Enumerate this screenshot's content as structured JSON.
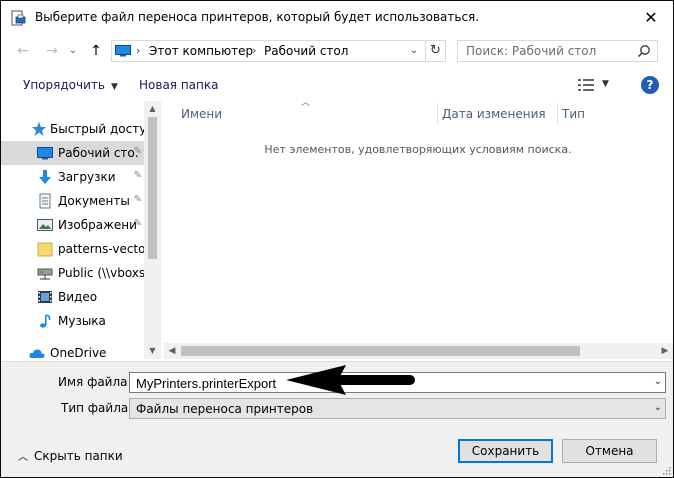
{
  "window": {
    "title": "Выберите файл переноса принтеров, который будет использоваться.",
    "close_glyph": "✕"
  },
  "navigation": {
    "back_glyph": "←",
    "forward_glyph": "→",
    "recent_glyph": "⌄",
    "up_glyph": "↑"
  },
  "address": {
    "crumbs": [
      "Этот компьютер",
      "Рабочий стол"
    ],
    "separator": "›",
    "dropdown_glyph": "⌄",
    "refresh_glyph": "↻"
  },
  "search": {
    "placeholder": "Поиск: Рабочий стол"
  },
  "toolbar": {
    "organize_label": "Упорядочить",
    "new_folder_label": "Новая папка",
    "help_glyph": "?"
  },
  "sidebar": {
    "items": [
      {
        "label": "Быстрый доступ",
        "icon": "star-icon",
        "pinned": false
      },
      {
        "label": "Рабочий сто.",
        "icon": "desktop-icon",
        "pinned": true,
        "selected": true
      },
      {
        "label": "Загрузки",
        "icon": "download-icon",
        "pinned": true
      },
      {
        "label": "Документы",
        "icon": "document-icon",
        "pinned": true
      },
      {
        "label": "Изображени",
        "icon": "pictures-icon",
        "pinned": true
      },
      {
        "label": "patterns-vector-",
        "icon": "folder-icon",
        "pinned": false
      },
      {
        "label": "Public (\\\\vboxsrv",
        "icon": "network-drive-icon",
        "pinned": false
      },
      {
        "label": "Видео",
        "icon": "video-icon",
        "pinned": false
      },
      {
        "label": "Музыка",
        "icon": "music-icon",
        "pinned": false
      },
      {
        "label": "OneDrive",
        "icon": "cloud-icon",
        "pinned": false
      }
    ],
    "pin_glyph": "📌"
  },
  "file_list": {
    "columns": [
      "Имени",
      "Дата изменения",
      "Тип"
    ],
    "empty_message": "Нет элементов, удовлетворяющих условиям поиска."
  },
  "bottom": {
    "filename_label": "Имя файла:",
    "filename_value": "MyPrinters.printerExport",
    "filetype_label": "Тип файла:",
    "filetype_value": "Файлы переноса принтеров",
    "hide_folders_label": "Скрыть папки",
    "save_label": "Сохранить",
    "cancel_label": "Отмена"
  },
  "colors": {
    "accent": "#0078d7",
    "help": "#1e5fb4",
    "selected_item": "#d9d9d9",
    "column_header": "#4c607a"
  }
}
